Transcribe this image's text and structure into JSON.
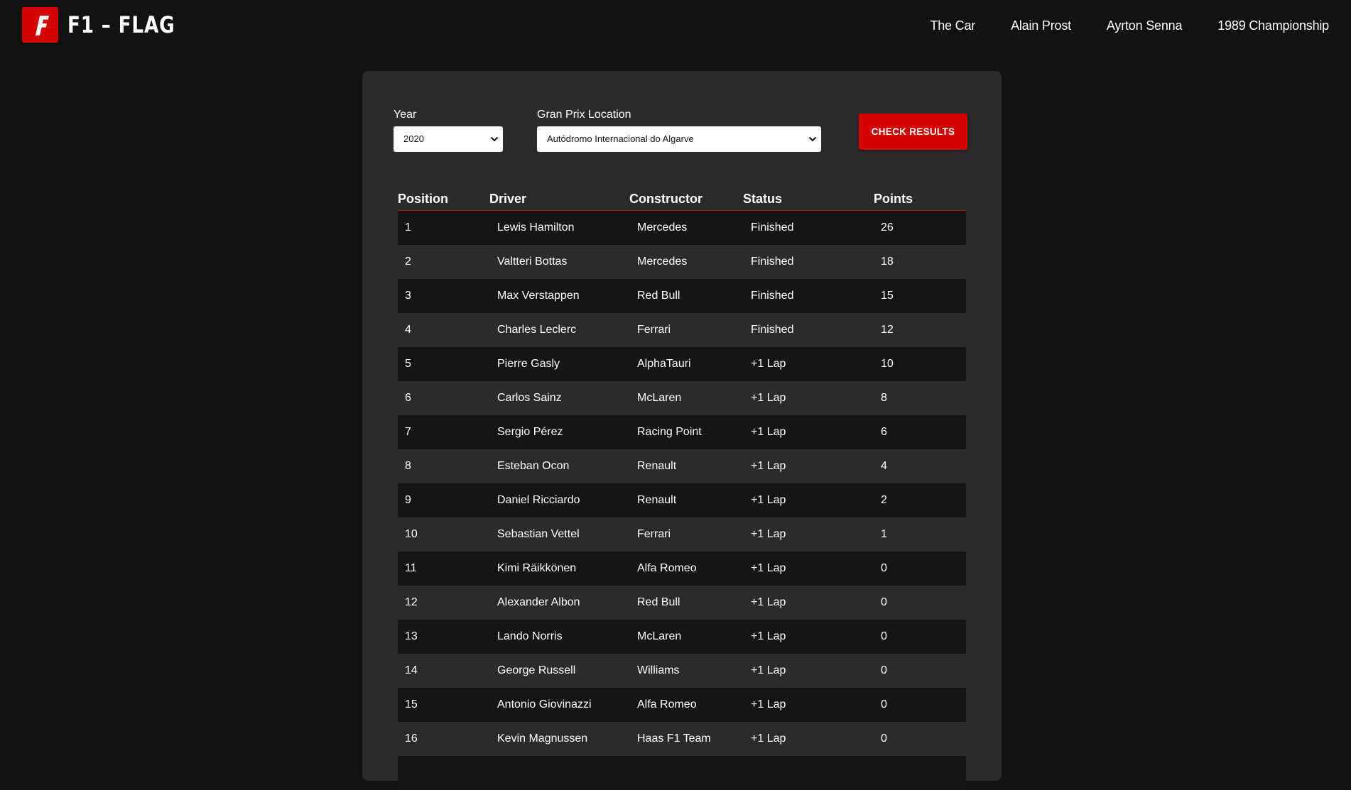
{
  "brand": {
    "name": "F1 – FLAG",
    "logo_letter": "F",
    "accent_color": "#d50000"
  },
  "nav": {
    "items": [
      {
        "label": "The Car"
      },
      {
        "label": "Alain Prost"
      },
      {
        "label": "Ayrton Senna"
      },
      {
        "label": "1989 Championship"
      }
    ]
  },
  "filters": {
    "year_label": "Year",
    "year_value": "2020",
    "location_label": "Gran Prix Location",
    "location_value": "Autódromo Internacional do Algarve",
    "check_button": "CHECK RESULTS"
  },
  "table": {
    "headers": [
      "Position",
      "Driver",
      "Constructor",
      "Status",
      "Points"
    ],
    "rows": [
      [
        "1",
        "Lewis Hamilton",
        "Mercedes",
        "Finished",
        "26"
      ],
      [
        "2",
        "Valtteri Bottas",
        "Mercedes",
        "Finished",
        "18"
      ],
      [
        "3",
        "Max Verstappen",
        "Red Bull",
        "Finished",
        "15"
      ],
      [
        "4",
        "Charles Leclerc",
        "Ferrari",
        "Finished",
        "12"
      ],
      [
        "5",
        "Pierre Gasly",
        "AlphaTauri",
        "+1 Lap",
        "10"
      ],
      [
        "6",
        "Carlos Sainz",
        "McLaren",
        "+1 Lap",
        "8"
      ],
      [
        "7",
        "Sergio Pérez",
        "Racing Point",
        "+1 Lap",
        "6"
      ],
      [
        "8",
        "Esteban Ocon",
        "Renault",
        "+1 Lap",
        "4"
      ],
      [
        "9",
        "Daniel Ricciardo",
        "Renault",
        "+1 Lap",
        "2"
      ],
      [
        "10",
        "Sebastian Vettel",
        "Ferrari",
        "+1 Lap",
        "1"
      ],
      [
        "11",
        "Kimi Räikkönen",
        "Alfa Romeo",
        "+1 Lap",
        "0"
      ],
      [
        "12",
        "Alexander Albon",
        "Red Bull",
        "+1 Lap",
        "0"
      ],
      [
        "13",
        "Lando Norris",
        "McLaren",
        "+1 Lap",
        "0"
      ],
      [
        "14",
        "George Russell",
        "Williams",
        "+1 Lap",
        "0"
      ],
      [
        "15",
        "Antonio Giovinazzi",
        "Alfa Romeo",
        "+1 Lap",
        "0"
      ],
      [
        "16",
        "Kevin Magnussen",
        "Haas F1 Team",
        "+1 Lap",
        "0"
      ],
      [
        "",
        "",
        "",
        "",
        ""
      ]
    ]
  }
}
